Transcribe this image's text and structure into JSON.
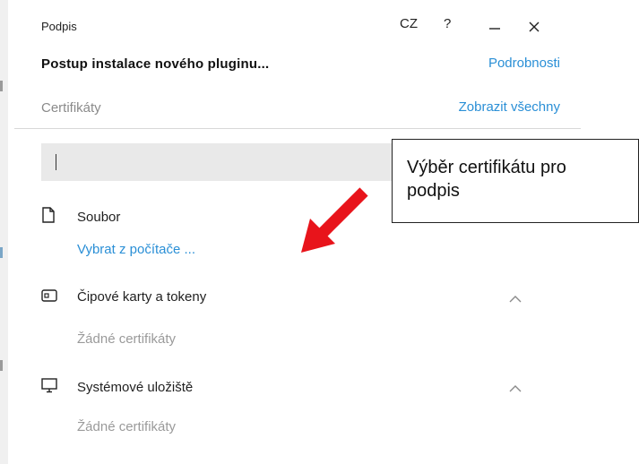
{
  "window": {
    "title": "Podpis",
    "language": "CZ",
    "help_label": "?"
  },
  "header": {
    "heading": "Postup instalace nového pluginu...",
    "details_link": "Podrobnosti"
  },
  "certificates": {
    "label": "Certifikáty",
    "show_all_link": "Zobrazit všechny"
  },
  "search": {
    "value": "",
    "placeholder": ""
  },
  "sections": {
    "file": {
      "icon": "file-icon",
      "title": "Soubor",
      "action_link": "Vybrat z počítače ..."
    },
    "smartcards": {
      "icon": "smartcard-icon",
      "title": "Čipové karty a tokeny",
      "empty": "Žádné certifikáty",
      "expanded": true
    },
    "system": {
      "icon": "monitor-icon",
      "title": "Systémové uložiště",
      "empty": "Žádné certifikáty",
      "expanded": true
    }
  },
  "annotation": {
    "callout_text": "Výběr certifikátu pro podpis",
    "arrow_color": "#e8141b"
  },
  "colors": {
    "accent": "#2a8fd6",
    "muted": "#9a9a9a",
    "search_bg": "#e9e9e9"
  }
}
